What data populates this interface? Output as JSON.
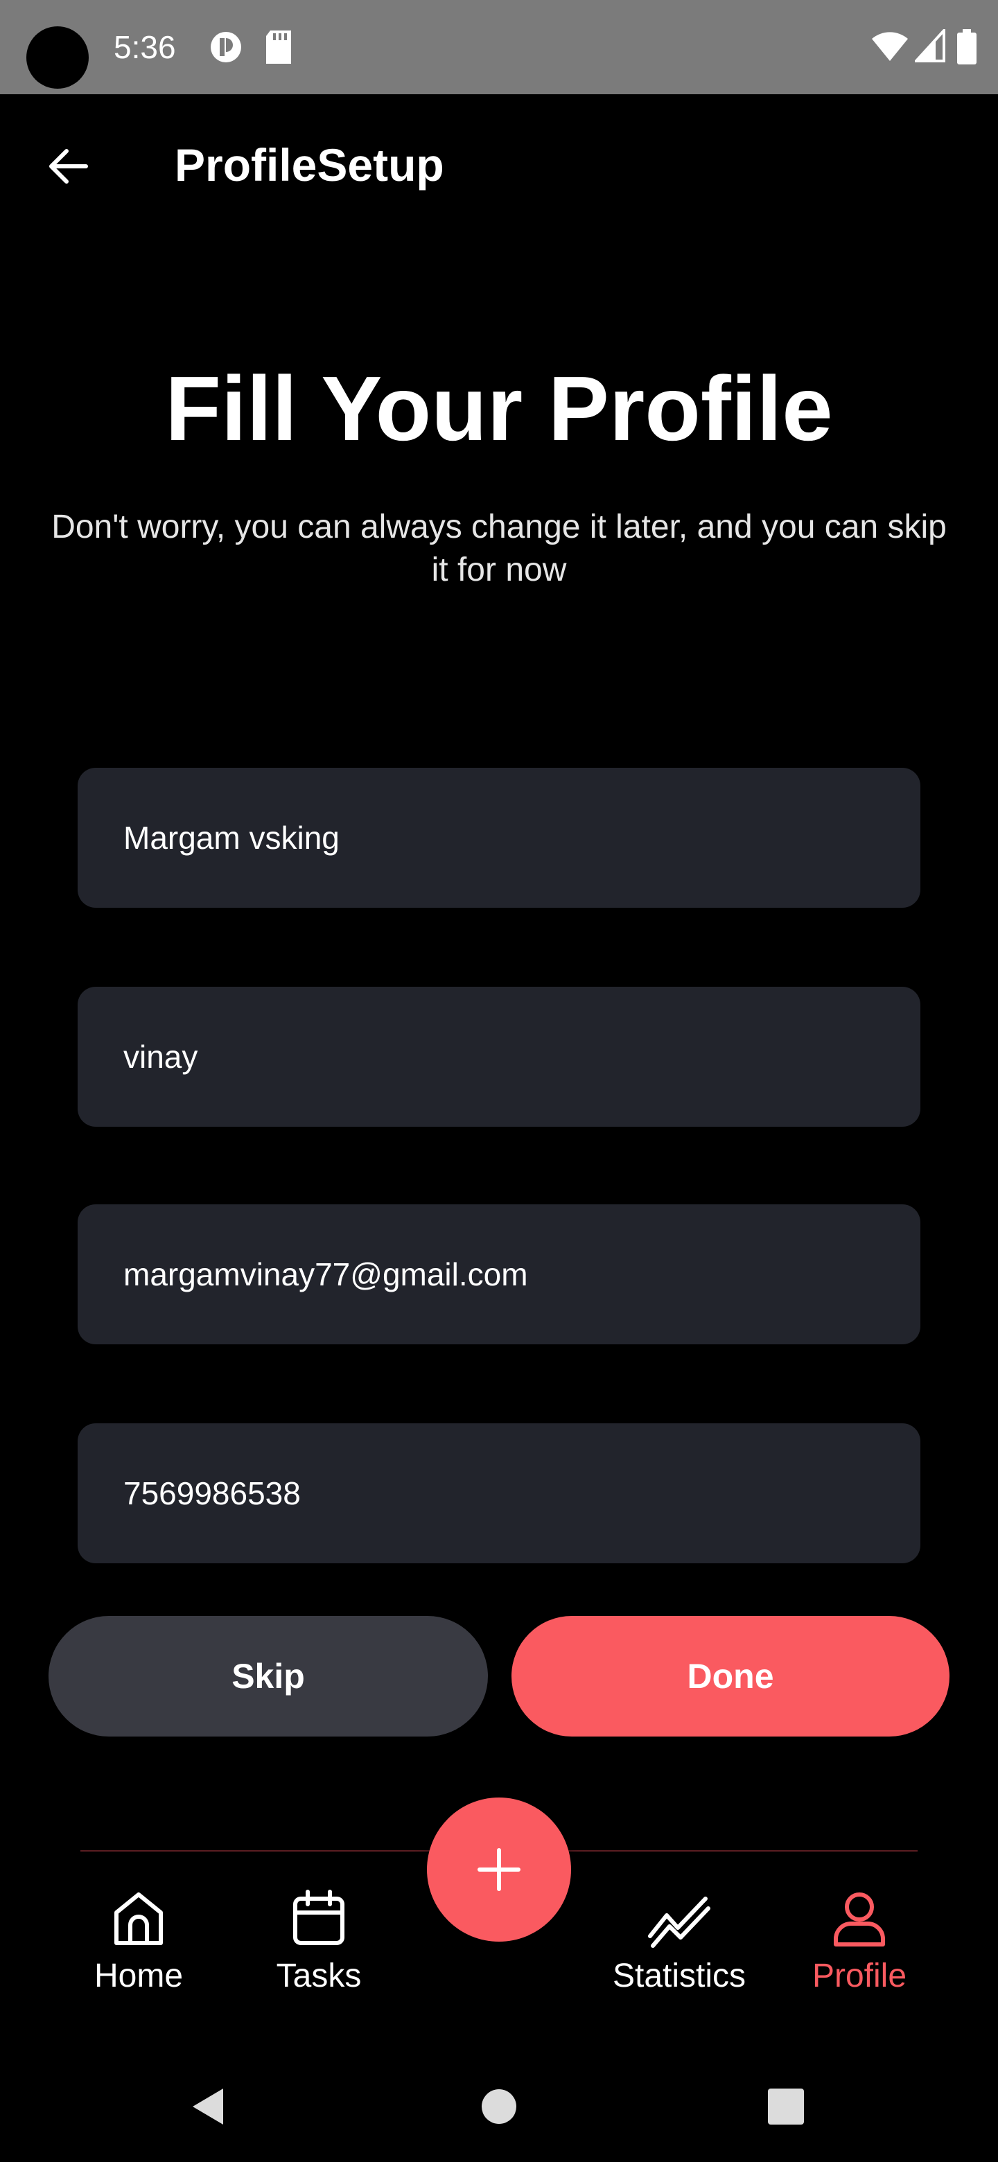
{
  "status_bar": {
    "time": "5:36"
  },
  "app_bar": {
    "title": "ProfileSetup",
    "back_icon": "arrow-left-icon"
  },
  "heading": {
    "title": "Fill Your Profile",
    "subtitle": "Don't worry, you can always change it later, and you can skip it for now"
  },
  "form": {
    "fields": [
      {
        "value": "Margam vsking"
      },
      {
        "value": "vinay"
      },
      {
        "value": "margamvinay77@gmail.com"
      },
      {
        "value": "7569986538"
      }
    ]
  },
  "actions": {
    "skip_label": "Skip",
    "done_label": "Done"
  },
  "bottom_nav": {
    "items": [
      {
        "label": "Home",
        "icon": "home-icon"
      },
      {
        "label": "Tasks",
        "icon": "calendar-icon"
      },
      {
        "label": "Statistics",
        "icon": "chart-line-icon"
      },
      {
        "label": "Profile",
        "icon": "user-icon",
        "active": true
      }
    ],
    "fab_icon": "plus-icon"
  },
  "colors": {
    "accent": "#fa5a60",
    "field_bg": "#22242c",
    "skip_bg": "#393a42",
    "background": "#000000"
  }
}
